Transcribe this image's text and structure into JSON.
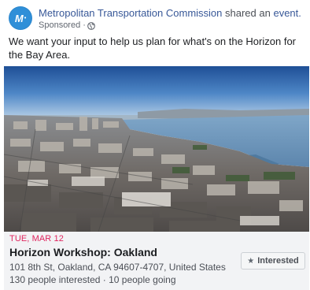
{
  "post": {
    "page_name": "Metropolitan Transportation Commission",
    "shared_text": "shared an",
    "event_link": "event.",
    "sponsored": "Sponsored · ",
    "privacy_icon": "globe-icon",
    "avatar_icon": "mtc-logo-icon",
    "message": "We want your input to help us plan for what's on the Horizon for the Bay Area."
  },
  "event": {
    "date": "TUE, MAR 12",
    "title": "Horizon Workshop: Oakland",
    "address": "101 8th St, Oakland, CA 94607-4707, United States",
    "stats": "130 people interested · 10 people going",
    "interested_label": "Interested",
    "interested_icon": "star-icon"
  },
  "colors": {
    "link": "#385898",
    "date": "#e0245e",
    "card_bg": "#f2f3f5",
    "avatar": "#2f8fd8"
  }
}
